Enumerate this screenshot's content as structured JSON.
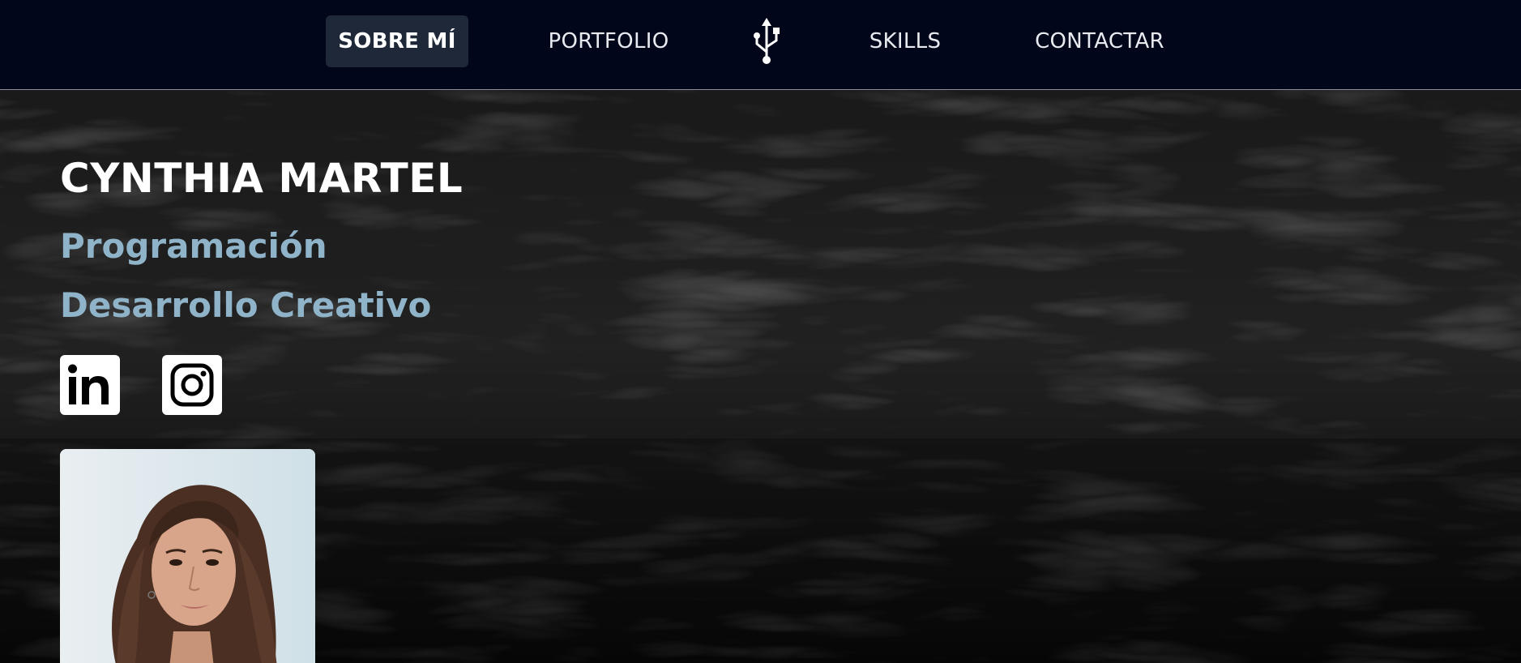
{
  "nav": {
    "items": [
      {
        "label": "SOBRE MÍ",
        "active": true
      },
      {
        "label": "PORTFOLIO",
        "active": false
      },
      {
        "label": "SKILLS",
        "active": false
      },
      {
        "label": "CONTACTAR",
        "active": false
      }
    ],
    "logo_icon": "usb-icon"
  },
  "hero": {
    "name": "CYNTHIA MARTEL",
    "subtitles": [
      "Programación",
      "Desarrollo Creativo"
    ],
    "social": [
      {
        "icon": "linkedin-icon",
        "label": "in"
      },
      {
        "icon": "instagram-icon"
      }
    ],
    "photo": "profile-photo"
  },
  "colors": {
    "nav_bg": "#02061a",
    "nav_active_bg": "#1e2838",
    "name_color": "#ffffff",
    "subtitle_color": "#8fb3c8"
  }
}
